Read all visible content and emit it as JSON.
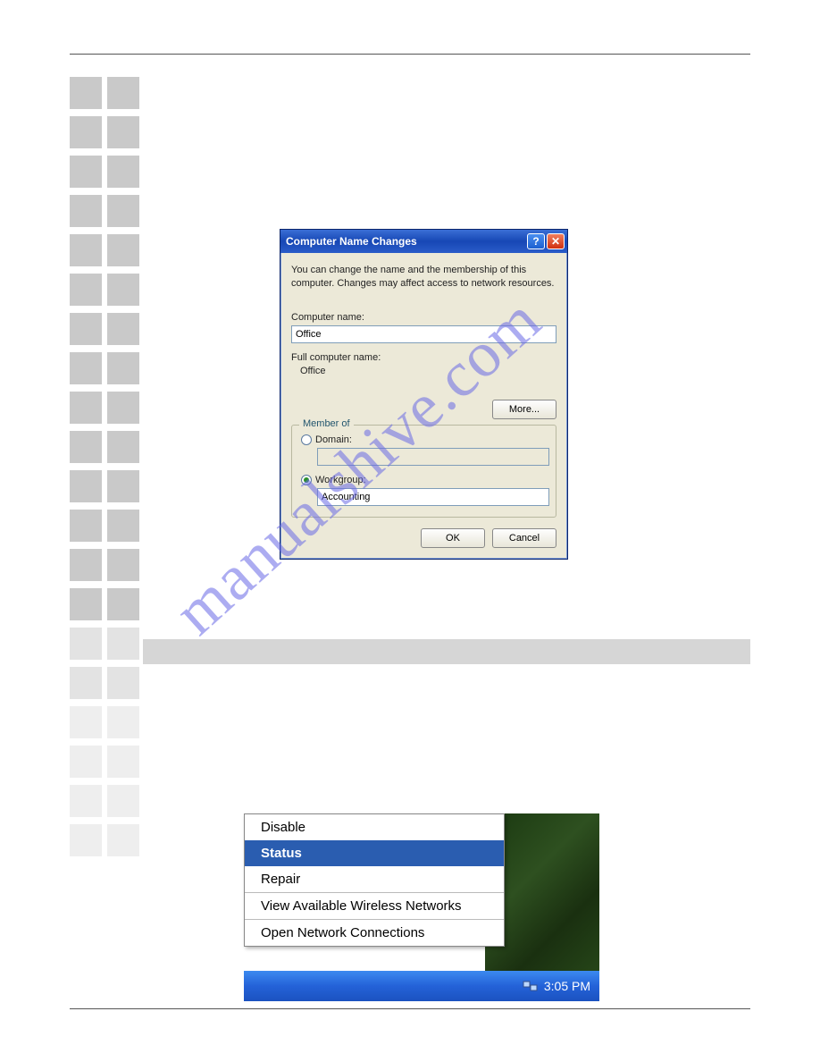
{
  "watermark": "manualshive.com",
  "dialog": {
    "title": "Computer Name Changes",
    "intro": "You can change the name and the membership of this computer. Changes may affect access to network resources.",
    "computer_name_label": "Computer name:",
    "computer_name_value": "Office",
    "full_name_label": "Full computer name:",
    "full_name_value": "Office",
    "more_button": "More...",
    "member_of_legend": "Member of",
    "domain_label": "Domain:",
    "domain_value": "",
    "workgroup_label": "Workgroup:",
    "workgroup_value": "Accounting",
    "ok_button": "OK",
    "cancel_button": "Cancel"
  },
  "context_menu": {
    "items": [
      "Disable",
      "Status",
      "Repair",
      "View Available Wireless Networks",
      "Open Network Connections"
    ],
    "selected_index": 1
  },
  "taskbar": {
    "time": "3:05 PM"
  }
}
